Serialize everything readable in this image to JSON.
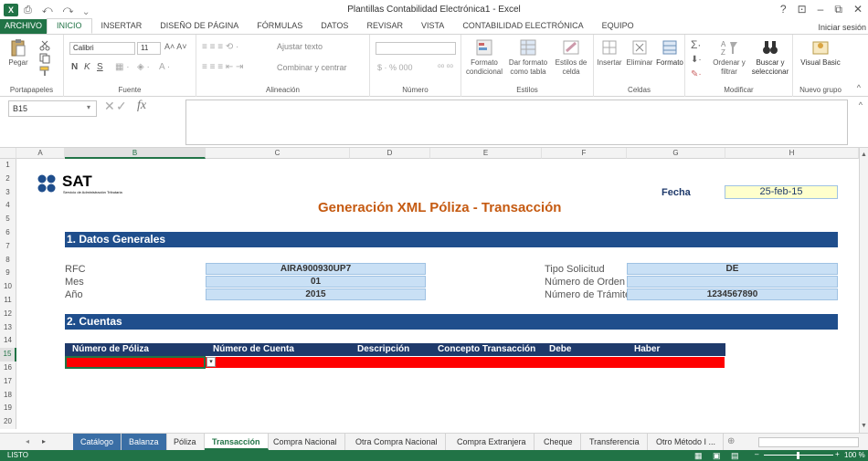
{
  "window": {
    "title": "Plantillas Contabilidad Electrónica1 - Excel",
    "logo": "X"
  },
  "quick_access": "⎙ ↶ ↷ ⌄",
  "window_controls": {
    "help": "?",
    "restore_ribbon": "⊡",
    "minimize": "–",
    "maximize": "⧉",
    "close": "✕"
  },
  "menu": {
    "file": "ARCHIVO",
    "tabs": [
      "INICIO",
      "INSERTAR",
      "DISEÑO DE PÁGINA",
      "FÓRMULAS",
      "DATOS",
      "REVISAR",
      "VISTA",
      "CONTABILIDAD ELECTRÓNICA",
      "EQUIPO"
    ],
    "signin": "Iniciar sesión"
  },
  "ribbon": {
    "clipboard": {
      "label": "Portapapeles",
      "paste": "Pegar"
    },
    "font": {
      "label": "Fuente",
      "name": "Calibri",
      "size": "11",
      "bold": "N",
      "italic": "K",
      "underline": "S"
    },
    "alignment": {
      "label": "Alineación",
      "wrap": "Ajustar texto",
      "merge": "Combinar y centrar"
    },
    "number": {
      "label": "Número",
      "format": "",
      "currency": "$ · % 000"
    },
    "styles": {
      "label": "Estilos",
      "conditional": "Formato condicional",
      "table": "Dar formato como tabla",
      "cell": "Estilos de celda"
    },
    "cells": {
      "label": "Celdas",
      "insert": "Insertar",
      "delete": "Eliminar",
      "format": "Formato"
    },
    "editing": {
      "label": "Modificar",
      "sort": "Ordenar y filtrar",
      "find": "Buscar y seleccionar"
    },
    "newgroup": {
      "label": "Nuevo grupo",
      "vb": "Visual Basic"
    }
  },
  "formula_bar": {
    "namebox": "B15",
    "fx": "fx",
    "value": ""
  },
  "columns": [
    "A",
    "B",
    "C",
    "D",
    "E",
    "F",
    "G",
    "H"
  ],
  "rows": [
    "1",
    "2",
    "3",
    "4",
    "5",
    "6",
    "7",
    "8",
    "9",
    "10",
    "11",
    "12",
    "13",
    "14",
    "15",
    "16",
    "17",
    "18",
    "19",
    "20"
  ],
  "sheet": {
    "logo_text": "SAT",
    "logo_sub": "Servicio de Administración Tributaria",
    "title": "Generación XML Póliza - Transacción",
    "fecha_label": "Fecha",
    "fecha_value": "25-feb-15",
    "section1": "1. Datos Generales",
    "rfc_label": "RFC",
    "rfc_value": "AIRA900930UP7",
    "mes_label": "Mes",
    "mes_value": "01",
    "anio_label": "Año",
    "anio_value": "2015",
    "tipo_label": "Tipo Solicitud",
    "tipo_value": "DE",
    "orden_label": "Número de Orden",
    "orden_value": "",
    "tramite_label": "Número de Trámite",
    "tramite_value": "1234567890",
    "section2": "2. Cuentas",
    "table_headers": [
      "Número de Póliza",
      "Número de Cuenta",
      "Descripción",
      "Concepto Transacción",
      "Debe",
      "Haber"
    ]
  },
  "sheet_tabs": [
    "Catálogo",
    "Balanza",
    "Póliza",
    "Transacción",
    "Compra Nacional",
    "Otra Compra Nacional",
    "Compra Extranjera",
    "Cheque",
    "Transferencia",
    "Otro Método I ..."
  ],
  "status": {
    "ready": "LISTO",
    "zoom": "100 %"
  }
}
